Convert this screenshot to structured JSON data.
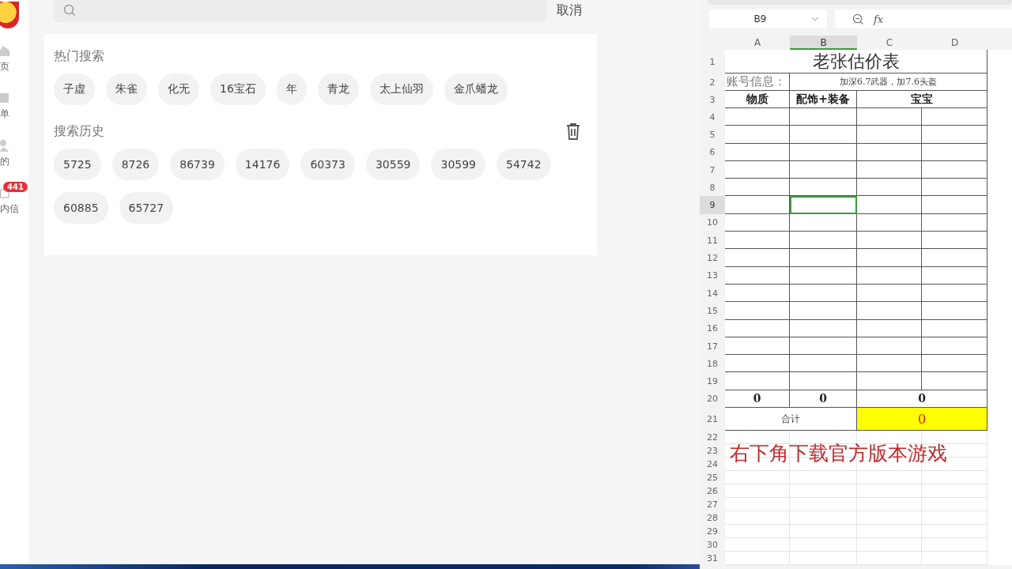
{
  "sidebar": {
    "items": [
      {
        "label": "页"
      },
      {
        "label": "单"
      },
      {
        "label": "的"
      },
      {
        "label": "内信",
        "badge": "441"
      }
    ]
  },
  "search": {
    "cancel": "取消"
  },
  "hot": {
    "title": "热门搜索",
    "tags": [
      "子虚",
      "朱雀",
      "化无",
      "16宝石",
      "年",
      "青龙",
      "太上仙羽",
      "金爪蟠龙"
    ]
  },
  "history": {
    "title": "搜索历史",
    "tags": [
      "5725",
      "8726",
      "86739",
      "14176",
      "60373",
      "30559",
      "30599",
      "54742",
      "60885",
      "65727"
    ]
  },
  "sheet": {
    "name_box": "B9",
    "formula_icon": "fx",
    "columns": [
      {
        "label": "A",
        "selected": false
      },
      {
        "label": "B",
        "selected": true
      },
      {
        "label": "C",
        "selected": false
      },
      {
        "label": "D",
        "selected": false
      }
    ],
    "rows": [
      {
        "header": "1",
        "kind": "table",
        "selected": false,
        "cells": [
          {
            "text": "老张估价表",
            "kind": "title"
          }
        ]
      },
      {
        "header": "2",
        "kind": "table",
        "selected": false,
        "cells": [
          {
            "text": "账号信息：",
            "kind": "label"
          },
          {
            "text": "加深6.7武器，加7.6头盔",
            "kind": "small"
          }
        ]
      },
      {
        "header": "3",
        "kind": "table",
        "selected": false,
        "cells": [
          {
            "text": "物质",
            "kind": "bold"
          },
          {
            "text": "配饰+装备",
            "kind": "bold"
          },
          {
            "text": "宝宝",
            "kind": "bold"
          }
        ]
      },
      {
        "header": "4",
        "kind": "table",
        "selected": false
      },
      {
        "header": "5",
        "kind": "table",
        "selected": false
      },
      {
        "header": "6",
        "kind": "table",
        "selected": false
      },
      {
        "header": "7",
        "kind": "table",
        "selected": false
      },
      {
        "header": "8",
        "kind": "table",
        "selected": false
      },
      {
        "header": "9",
        "kind": "table",
        "selected": true
      },
      {
        "header": "10",
        "kind": "table",
        "selected": false
      },
      {
        "header": "11",
        "kind": "table",
        "selected": false
      },
      {
        "header": "12",
        "kind": "table",
        "selected": false
      },
      {
        "header": "13",
        "kind": "table",
        "selected": false
      },
      {
        "header": "14",
        "kind": "table",
        "selected": false
      },
      {
        "header": "15",
        "kind": "table",
        "selected": false
      },
      {
        "header": "16",
        "kind": "table",
        "selected": false
      },
      {
        "header": "17",
        "kind": "table",
        "selected": false
      },
      {
        "header": "18",
        "kind": "table",
        "selected": false
      },
      {
        "header": "19",
        "kind": "table",
        "selected": false
      },
      {
        "header": "20",
        "kind": "table",
        "selected": false,
        "cells": [
          {
            "text": "0",
            "kind": "bold"
          },
          {
            "text": "0",
            "kind": "bold"
          },
          {
            "text": "0",
            "kind": "bold"
          }
        ]
      },
      {
        "header": "21",
        "kind": "table",
        "selected": false,
        "cells": [
          {
            "text": "合计",
            "kind": "plain"
          },
          {
            "text": "0",
            "kind": "total"
          }
        ]
      },
      {
        "header": "22",
        "kind": "blank",
        "selected": false
      },
      {
        "header": "23",
        "kind": "blank",
        "selected": false
      },
      {
        "header": "24",
        "kind": "blank",
        "selected": false
      },
      {
        "header": "25",
        "kind": "blank",
        "selected": false
      },
      {
        "header": "26",
        "kind": "blank",
        "selected": false
      },
      {
        "header": "27",
        "kind": "blank",
        "selected": false
      },
      {
        "header": "28",
        "kind": "blank",
        "selected": false
      },
      {
        "header": "29",
        "kind": "blank",
        "selected": false
      },
      {
        "header": "30",
        "kind": "blank",
        "selected": false
      },
      {
        "header": "31",
        "kind": "blank",
        "selected": false
      }
    ],
    "note": "右下角下载官方版本游戏"
  }
}
